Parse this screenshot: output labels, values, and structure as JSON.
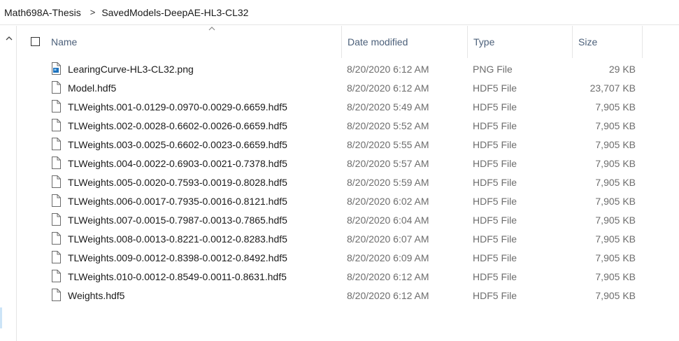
{
  "breadcrumb": {
    "items": [
      "Math698A-Thesis",
      "SavedModels-DeepAE-HL3-CL32"
    ],
    "separator": ">"
  },
  "columns": {
    "name": "Name",
    "date": "Date modified",
    "type": "Type",
    "size": "Size"
  },
  "files": [
    {
      "name": "LearingCurve-HL3-CL32.png",
      "date": "8/20/2020 6:12 AM",
      "type": "PNG File",
      "size": "29 KB",
      "icon": "image-file-icon"
    },
    {
      "name": "Model.hdf5",
      "date": "8/20/2020 6:12 AM",
      "type": "HDF5 File",
      "size": "23,707 KB",
      "icon": "file-icon"
    },
    {
      "name": "TLWeights.001-0.0129-0.0970-0.0029-0.6659.hdf5",
      "date": "8/20/2020 5:49 AM",
      "type": "HDF5 File",
      "size": "7,905 KB",
      "icon": "file-icon"
    },
    {
      "name": "TLWeights.002-0.0028-0.6602-0.0026-0.6659.hdf5",
      "date": "8/20/2020 5:52 AM",
      "type": "HDF5 File",
      "size": "7,905 KB",
      "icon": "file-icon"
    },
    {
      "name": "TLWeights.003-0.0025-0.6602-0.0023-0.6659.hdf5",
      "date": "8/20/2020 5:55 AM",
      "type": "HDF5 File",
      "size": "7,905 KB",
      "icon": "file-icon"
    },
    {
      "name": "TLWeights.004-0.0022-0.6903-0.0021-0.7378.hdf5",
      "date": "8/20/2020 5:57 AM",
      "type": "HDF5 File",
      "size": "7,905 KB",
      "icon": "file-icon"
    },
    {
      "name": "TLWeights.005-0.0020-0.7593-0.0019-0.8028.hdf5",
      "date": "8/20/2020 5:59 AM",
      "type": "HDF5 File",
      "size": "7,905 KB",
      "icon": "file-icon"
    },
    {
      "name": "TLWeights.006-0.0017-0.7935-0.0016-0.8121.hdf5",
      "date": "8/20/2020 6:02 AM",
      "type": "HDF5 File",
      "size": "7,905 KB",
      "icon": "file-icon"
    },
    {
      "name": "TLWeights.007-0.0015-0.7987-0.0013-0.7865.hdf5",
      "date": "8/20/2020 6:04 AM",
      "type": "HDF5 File",
      "size": "7,905 KB",
      "icon": "file-icon"
    },
    {
      "name": "TLWeights.008-0.0013-0.8221-0.0012-0.8283.hdf5",
      "date": "8/20/2020 6:07 AM",
      "type": "HDF5 File",
      "size": "7,905 KB",
      "icon": "file-icon"
    },
    {
      "name": "TLWeights.009-0.0012-0.8398-0.0012-0.8492.hdf5",
      "date": "8/20/2020 6:09 AM",
      "type": "HDF5 File",
      "size": "7,905 KB",
      "icon": "file-icon"
    },
    {
      "name": "TLWeights.010-0.0012-0.8549-0.0011-0.8631.hdf5",
      "date": "8/20/2020 6:12 AM",
      "type": "HDF5 File",
      "size": "7,905 KB",
      "icon": "file-icon"
    },
    {
      "name": "Weights.hdf5",
      "date": "8/20/2020 6:12 AM",
      "type": "HDF5 File",
      "size": "7,905 KB",
      "icon": "file-icon"
    }
  ],
  "colors": {
    "header_text": "#4c607a",
    "secondary_text": "#6d6d6d",
    "divider": "#e5e5e5",
    "nav_selection": "#cce4f7"
  }
}
